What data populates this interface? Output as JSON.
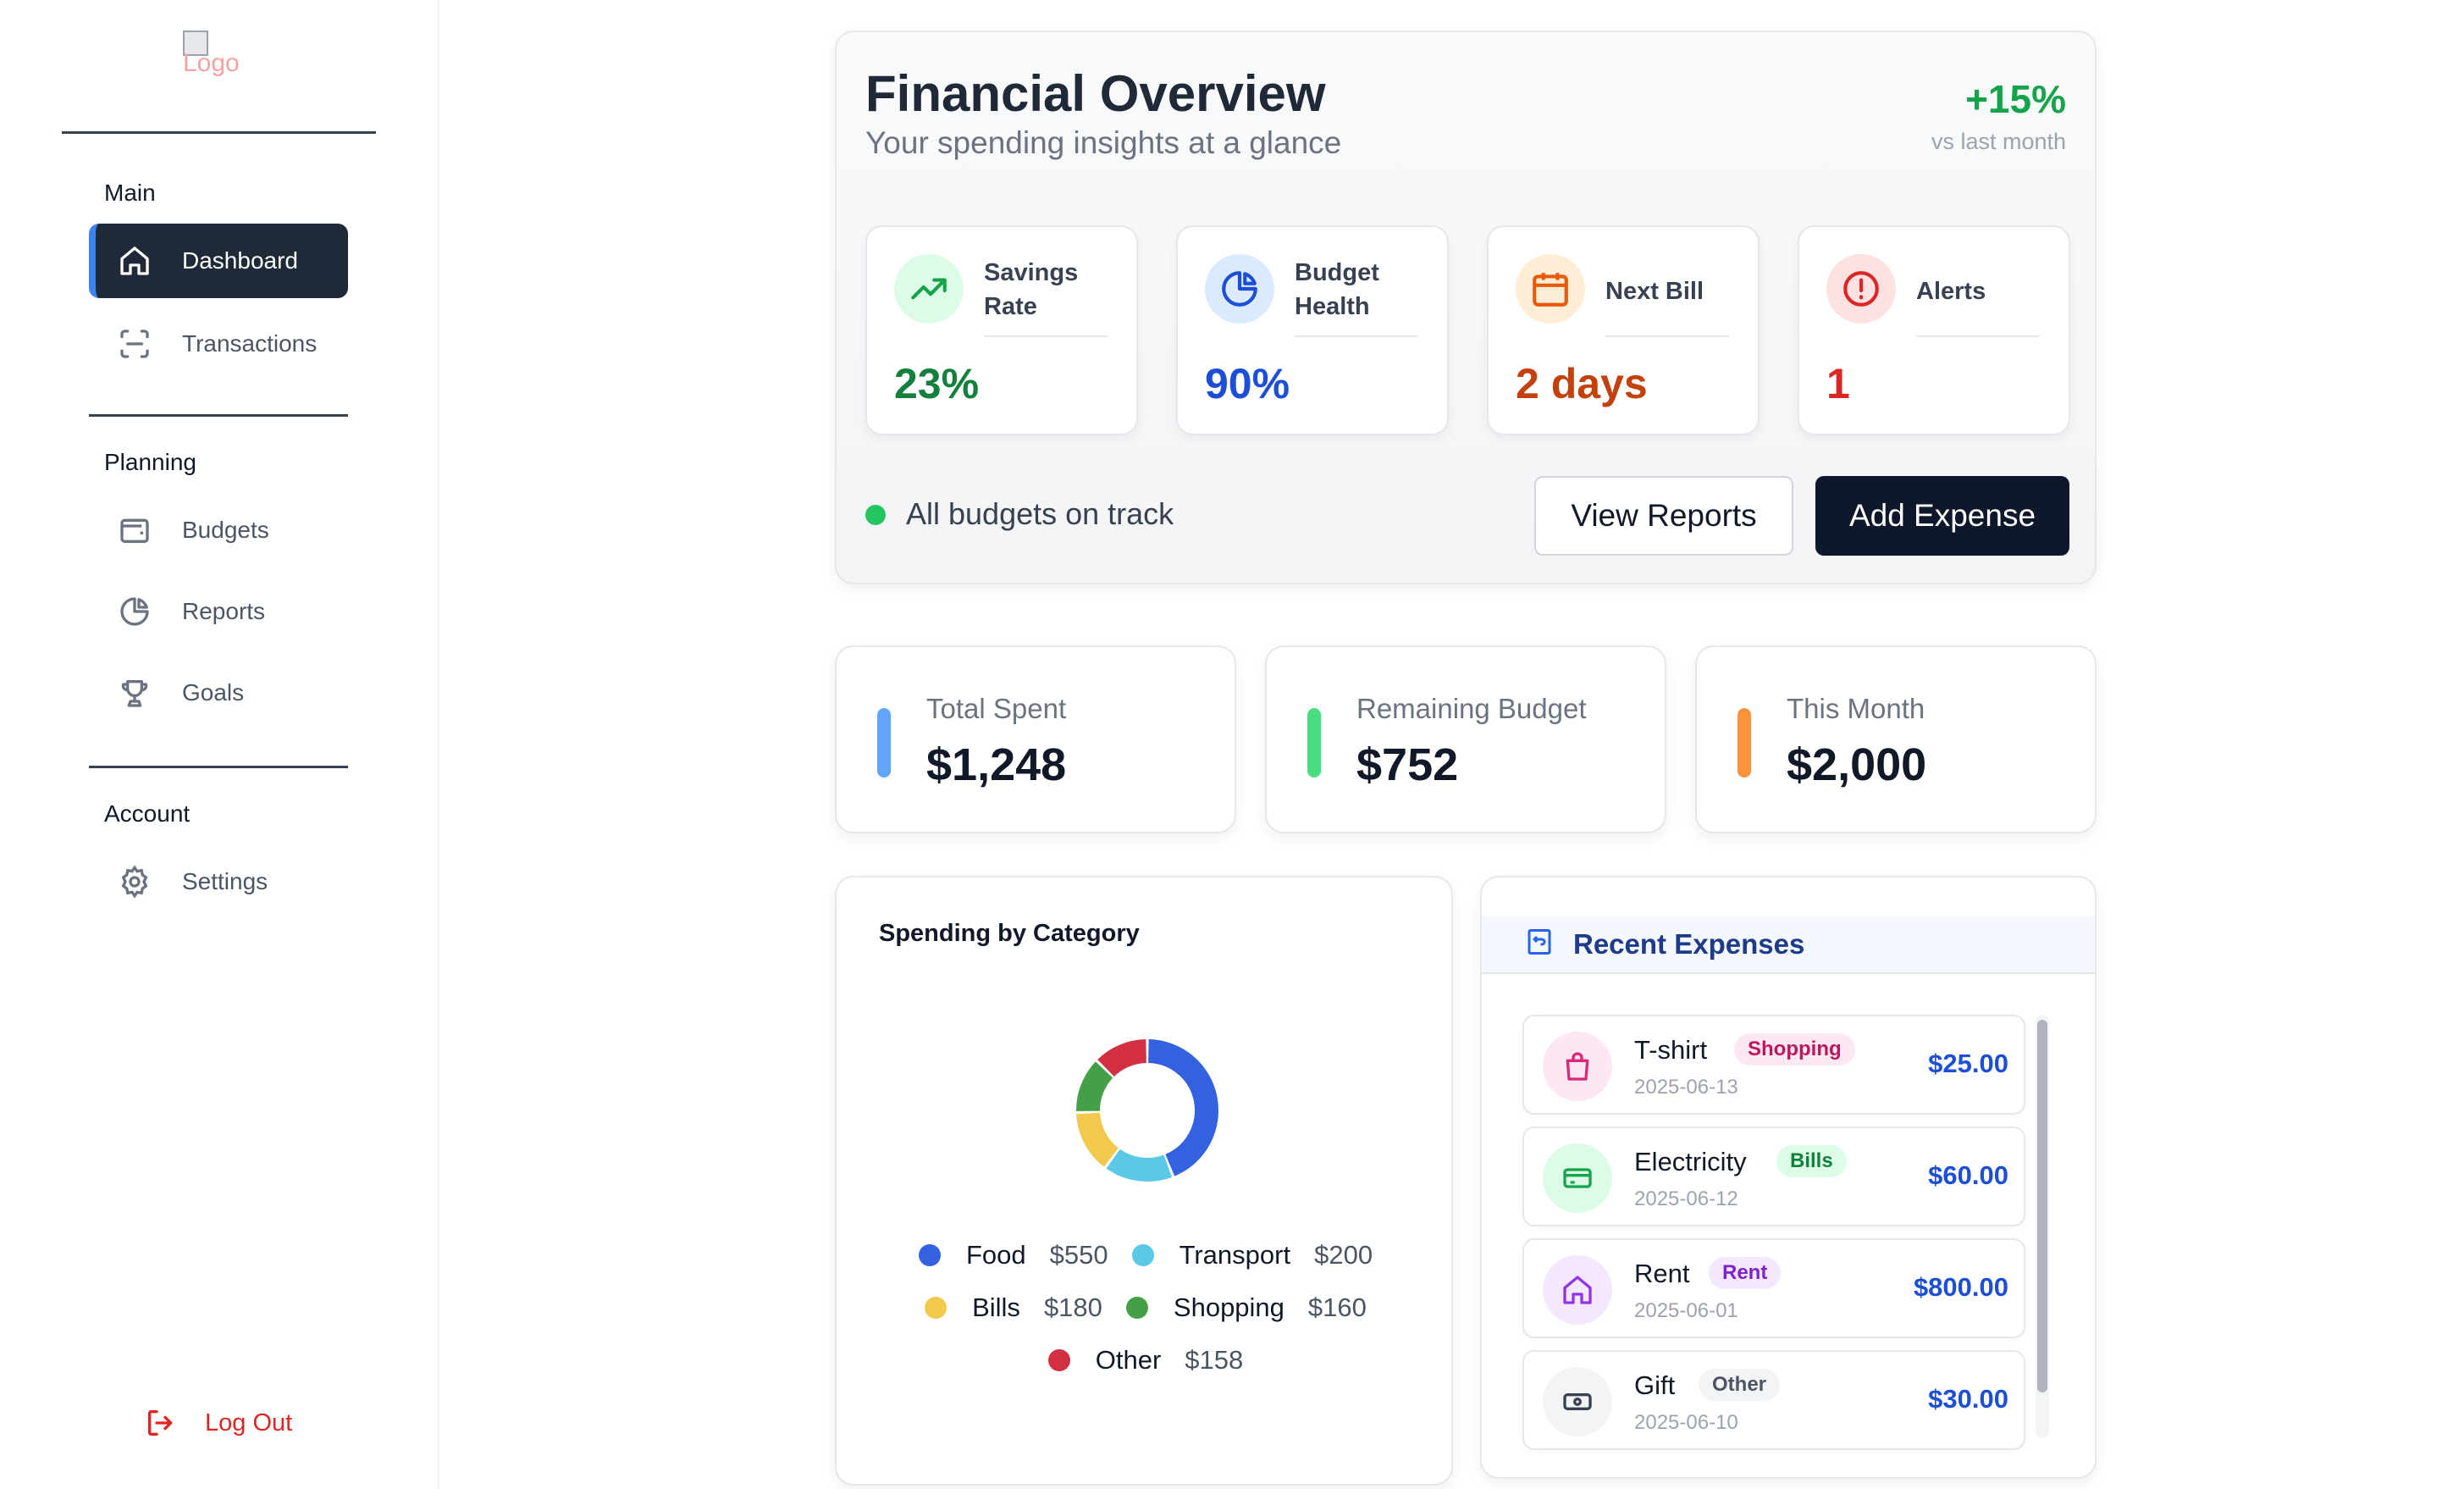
{
  "sidebar": {
    "logo_alt": "Logo",
    "sections": [
      {
        "label": "Main"
      },
      {
        "label": "Planning"
      },
      {
        "label": "Account"
      }
    ],
    "items": [
      {
        "label": "Dashboard",
        "icon": "home-icon",
        "active": true
      },
      {
        "label": "Transactions",
        "icon": "scan-icon"
      },
      {
        "label": "Budgets",
        "icon": "wallet-icon"
      },
      {
        "label": "Reports",
        "icon": "pie-chart-icon"
      },
      {
        "label": "Goals",
        "icon": "trophy-icon"
      },
      {
        "label": "Settings",
        "icon": "gear-icon"
      }
    ],
    "logout": "Log Out"
  },
  "overview": {
    "title": "Financial Overview",
    "subtitle": "Your spending insights at a glance",
    "delta": "+15%",
    "delta_sub": "vs last month",
    "stats": [
      {
        "label": "Savings Rate",
        "value": "23%",
        "icon": "trending-up-icon",
        "color": "#15803d",
        "bg": "#dcfce7"
      },
      {
        "label": "Budget Health",
        "value": "90%",
        "icon": "pie-chart-icon",
        "color": "#1d4ed8",
        "bg": "#dbeafe"
      },
      {
        "label": "Next Bill",
        "value": "2 days",
        "icon": "calendar-icon",
        "color": "#c2410c",
        "bg": "#ffedd5"
      },
      {
        "label": "Alerts",
        "value": "1",
        "icon": "alert-circle-icon",
        "color": "#dc2626",
        "bg": "#fee2e2"
      }
    ],
    "status": "All budgets on track",
    "view_reports": "View Reports",
    "add_expense": "Add Expense"
  },
  "metrics": [
    {
      "label": "Total Spent",
      "value": "$1,248",
      "color": "#60a5fa"
    },
    {
      "label": "Remaining Budget",
      "value": "$752",
      "color": "#4ade80"
    },
    {
      "label": "This Month",
      "value": "$2,000",
      "color": "#fb923c"
    }
  ],
  "spending": {
    "title": "Spending by Category"
  },
  "chart_data": {
    "type": "pie",
    "title": "Spending by Category",
    "categories": [
      "Food",
      "Transport",
      "Bills",
      "Shopping",
      "Other"
    ],
    "values": [
      550,
      200,
      180,
      160,
      158
    ],
    "labels": [
      "$550",
      "$200",
      "$180",
      "$160",
      "$158"
    ],
    "colors": [
      "#3461e0",
      "#5bc8e6",
      "#f2c94c",
      "#43a047",
      "#d32f43"
    ],
    "legend": "bottom"
  },
  "recent": {
    "title": "Recent Expenses",
    "items": [
      {
        "name": "T-shirt",
        "tag": "Shopping",
        "date": "2025-06-13",
        "amount": "$25.00",
        "icon": "shopping-bag-icon",
        "tag_bg": "#fce7f3",
        "tag_fg": "#be185d",
        "icon_bg": "#fce7f3",
        "icon_fg": "#db2777"
      },
      {
        "name": "Electricity",
        "tag": "Bills",
        "date": "2025-06-12",
        "amount": "$60.00",
        "icon": "credit-card-icon",
        "tag_bg": "#dcfce7",
        "tag_fg": "#15803d",
        "icon_bg": "#dcfce7",
        "icon_fg": "#16a34a"
      },
      {
        "name": "Rent",
        "tag": "Rent",
        "date": "2025-06-01",
        "amount": "$800.00",
        "icon": "home-icon",
        "tag_bg": "#f3e8ff",
        "tag_fg": "#7e22ce",
        "icon_bg": "#f3e8ff",
        "icon_fg": "#9333ea"
      },
      {
        "name": "Gift",
        "tag": "Other",
        "date": "2025-06-10",
        "amount": "$30.00",
        "icon": "banknote-icon",
        "tag_bg": "#f3f4f6",
        "tag_fg": "#4b5563",
        "icon_bg": "#f3f4f6",
        "icon_fg": "#374151"
      }
    ]
  }
}
